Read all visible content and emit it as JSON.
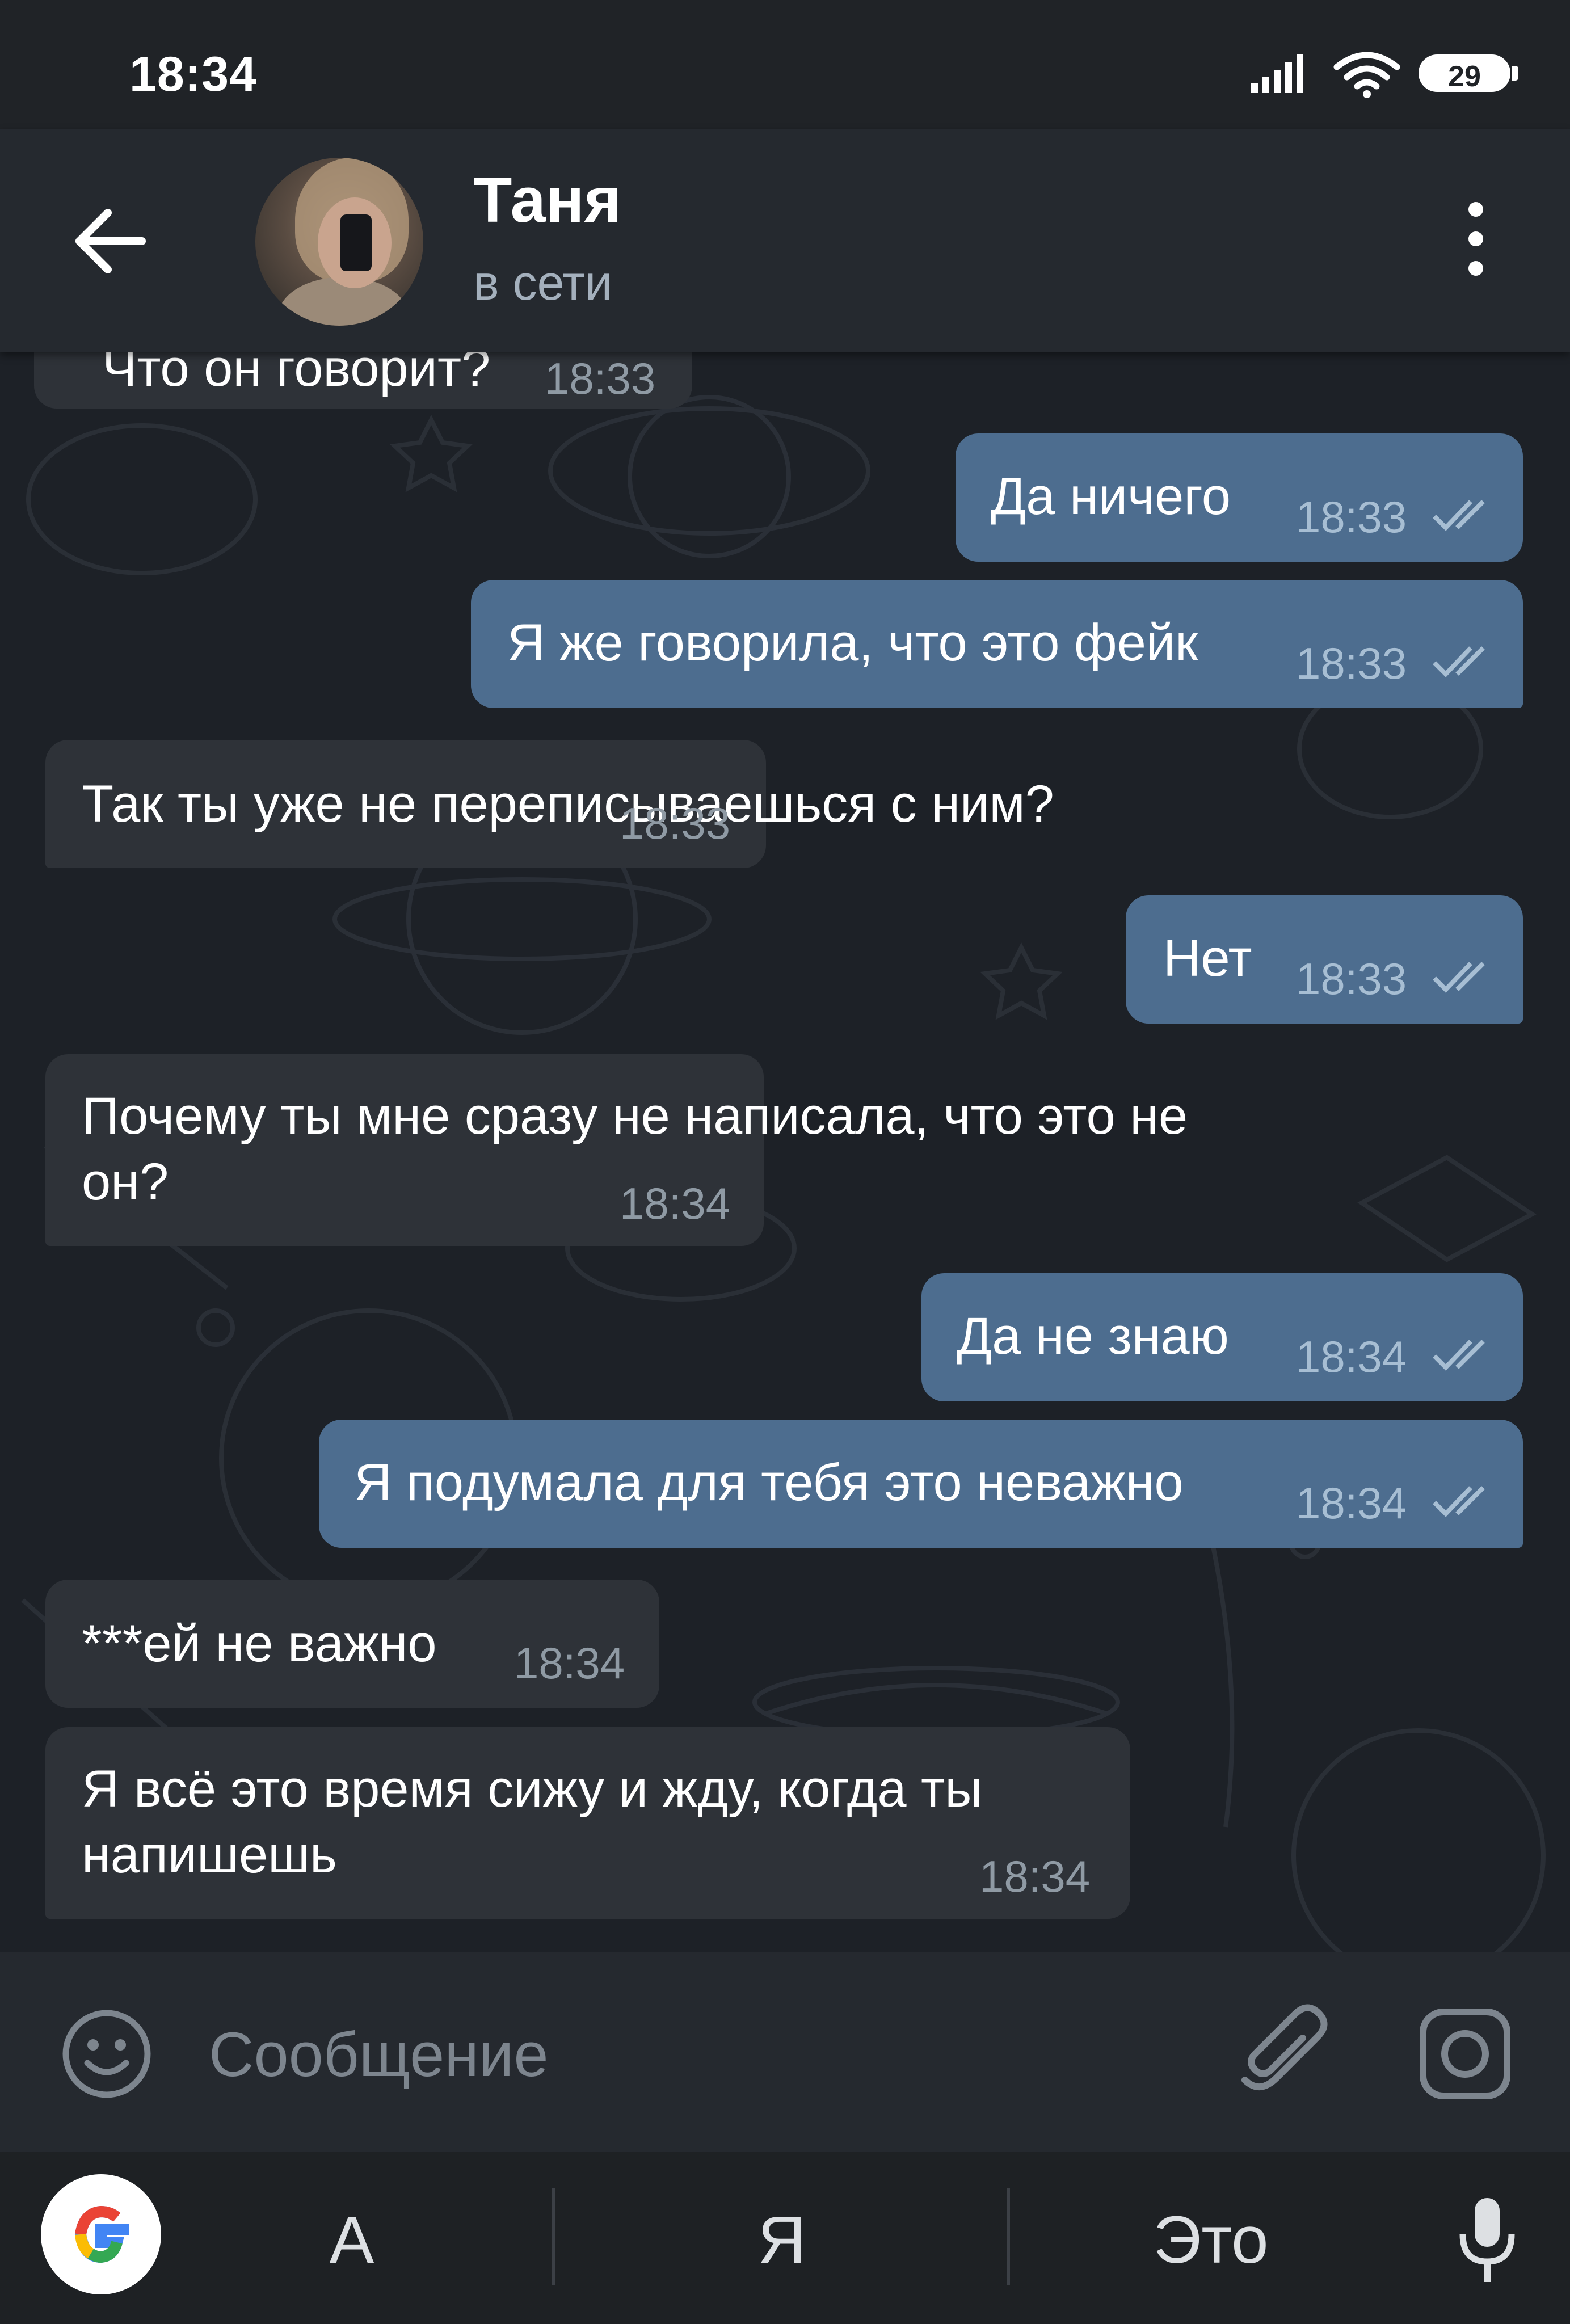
{
  "status_bar": {
    "time": "18:34",
    "battery": "29"
  },
  "header": {
    "name": "Таня",
    "status": "в сети"
  },
  "messages": [
    {
      "dir": "in",
      "text": "Что он говорит?",
      "time": "18:33"
    },
    {
      "dir": "out",
      "text": "Да ничего",
      "time": "18:33",
      "read": true
    },
    {
      "dir": "out",
      "text": "Я же говорила, что это фейк",
      "time": "18:33",
      "read": true
    },
    {
      "dir": "in",
      "text": "Так ты уже не переписываешься с ним?",
      "time": "18:33"
    },
    {
      "dir": "out",
      "text": "Нет",
      "time": "18:33",
      "read": true
    },
    {
      "dir": "in",
      "lines": [
        "Почему ты мне сразу не написала, что это не",
        "он?"
      ],
      "time": "18:34"
    },
    {
      "dir": "out",
      "text": "Да не знаю",
      "time": "18:34",
      "read": true
    },
    {
      "dir": "out",
      "text": "Я подумала для тебя это неважно",
      "time": "18:34",
      "read": true
    },
    {
      "dir": "in",
      "text": "***ей не важно",
      "time": "18:34"
    },
    {
      "dir": "in",
      "lines": [
        "Я всё это время сижу и жду, когда ты",
        "напишешь"
      ],
      "time": "18:34"
    }
  ],
  "composer": {
    "placeholder": "Сообщение"
  },
  "suggestions": [
    "А",
    "Я",
    "Это"
  ],
  "colors": {
    "incoming_bubble": "#2e3238",
    "outgoing_bubble": "#4d6d8f",
    "background": "#1d2127",
    "header": "#25292f"
  },
  "icons": [
    "back-arrow-icon",
    "more-vertical-icon",
    "emoji-icon",
    "attach-icon",
    "camera-icon",
    "google-icon",
    "microphone-icon",
    "signal-icon",
    "wifi-icon",
    "double-check-icon"
  ]
}
